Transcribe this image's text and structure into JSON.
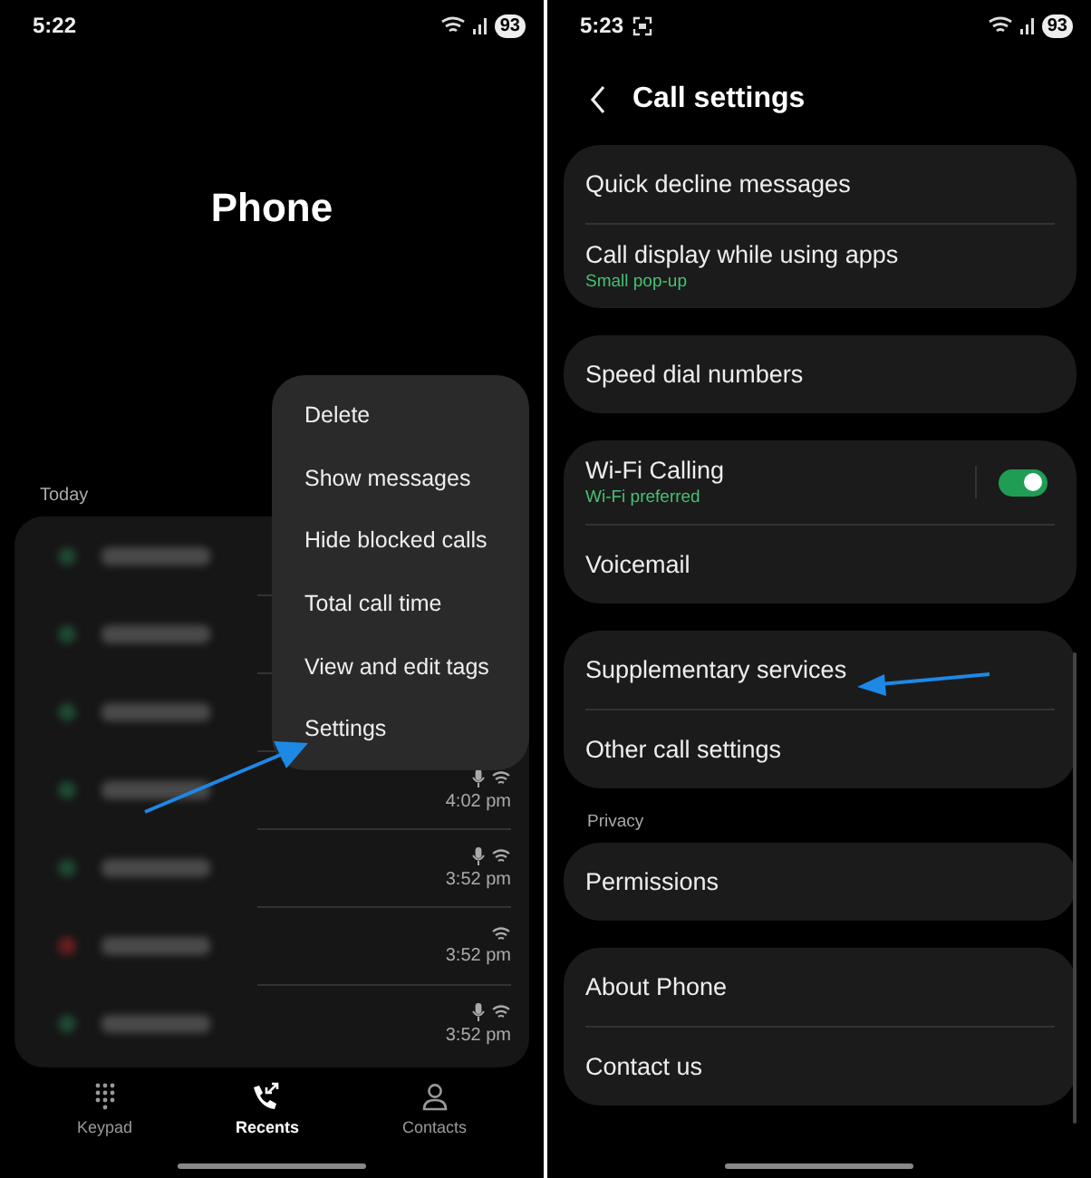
{
  "left_screen": {
    "status_bar": {
      "time": "5:22",
      "battery": "93"
    },
    "title": "Phone",
    "section_label": "Today",
    "calls": [
      {
        "missed": false
      },
      {
        "missed": false
      },
      {
        "missed": false
      },
      {
        "missed": false,
        "mic": true,
        "time": "4:02 pm"
      },
      {
        "missed": false,
        "mic": true,
        "time": "3:52 pm"
      },
      {
        "missed": true,
        "mic": false,
        "time": "3:52 pm"
      },
      {
        "missed": false,
        "mic": true,
        "time": "3:52 pm"
      }
    ],
    "menu": [
      "Delete",
      "Show messages",
      "Hide blocked calls",
      "Total call time",
      "View and edit tags",
      "Settings"
    ],
    "nav": [
      {
        "label": "Keypad",
        "selected": false
      },
      {
        "label": "Recents",
        "selected": true
      },
      {
        "label": "Contacts",
        "selected": false
      }
    ]
  },
  "right_screen": {
    "status_bar": {
      "time": "5:23",
      "battery": "93"
    },
    "title": "Call settings",
    "groups": [
      {
        "items": [
          {
            "label": "Quick decline messages"
          },
          {
            "label": "Call display while using apps",
            "sub": "Small pop-up"
          }
        ]
      },
      {
        "items": [
          {
            "label": "Speed dial numbers"
          }
        ]
      },
      {
        "items": [
          {
            "label": "Wi-Fi Calling",
            "sub": "Wi-Fi preferred",
            "kind": "toggle",
            "on": true
          },
          {
            "label": "Voicemail"
          }
        ]
      },
      {
        "items": [
          {
            "label": "Supplementary services"
          },
          {
            "label": "Other call settings"
          }
        ]
      },
      {
        "header": "Privacy",
        "items": [
          {
            "label": "Permissions"
          }
        ]
      },
      {
        "items": [
          {
            "label": "About Phone"
          },
          {
            "label": "Contact us"
          }
        ]
      }
    ]
  }
}
